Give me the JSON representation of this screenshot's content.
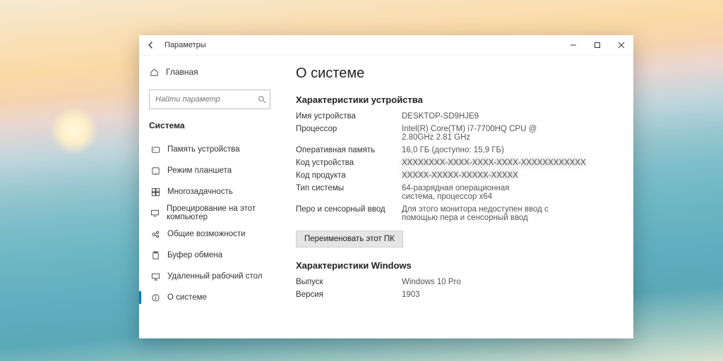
{
  "titlebar": {
    "back_aria": "Назад",
    "title": "Параметры"
  },
  "sidebar": {
    "home": "Главная",
    "search_placeholder": "Найти параметр",
    "section": "Система",
    "items": [
      {
        "label": "Память устройства"
      },
      {
        "label": "Режим планшета"
      },
      {
        "label": "Многозадачность"
      },
      {
        "label": "Проецирование на этот компьютер"
      },
      {
        "label": "Общие возможности"
      },
      {
        "label": "Буфер обмена"
      },
      {
        "label": "Удаленный рабочий стол"
      },
      {
        "label": "О системе"
      }
    ]
  },
  "content": {
    "heading": "О системе",
    "device_section": "Характеристики устройства",
    "specs": {
      "device_name_k": "Имя устройства",
      "device_name_v": "DESKTOP-SD9HJE9",
      "cpu_k": "Процессор",
      "cpu_v": "Intel(R) Core(TM) i7-7700HQ CPU @ 2.80GHz   2.81 GHz",
      "ram_k": "Оперативная память",
      "ram_v": "16,0 ГБ (доступно: 15,9 ГБ)",
      "devid_k": "Код устройства",
      "devid_v": "XXXXXXXX-XXXX-XXXX-XXXX-XXXXXXXXXXXX",
      "prodid_k": "Код продукта",
      "prodid_v": "XXXXX-XXXXX-XXXXX-XXXXX",
      "systype_k": "Тип системы",
      "systype_v": "64-разрядная операционная система, процессор x64",
      "pen_k": "Перо и сенсорный ввод",
      "pen_v": "Для этого монитора недоступен ввод с помощью пера и сенсорный ввод"
    },
    "rename_btn": "Переименовать этот ПК",
    "windows_section": "Характеристики Windows",
    "win": {
      "edition_k": "Выпуск",
      "edition_v": "Windows 10 Pro",
      "version_k": "Версия",
      "version_v": "1903"
    }
  }
}
